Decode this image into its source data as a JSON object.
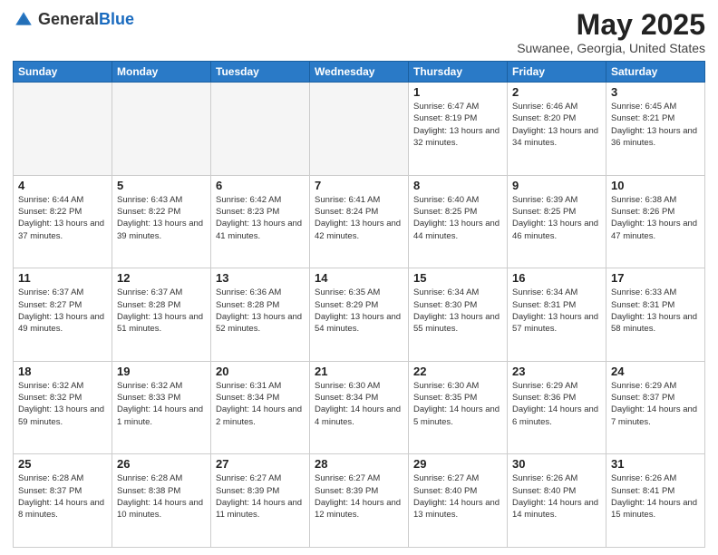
{
  "header": {
    "logo_general": "General",
    "logo_blue": "Blue",
    "month_year": "May 2025",
    "location": "Suwanee, Georgia, United States"
  },
  "days_of_week": [
    "Sunday",
    "Monday",
    "Tuesday",
    "Wednesday",
    "Thursday",
    "Friday",
    "Saturday"
  ],
  "weeks": [
    [
      {
        "day": "",
        "empty": true
      },
      {
        "day": "",
        "empty": true
      },
      {
        "day": "",
        "empty": true
      },
      {
        "day": "",
        "empty": true
      },
      {
        "day": "1",
        "sunrise": "6:47 AM",
        "sunset": "8:19 PM",
        "daylight": "13 hours and 32 minutes."
      },
      {
        "day": "2",
        "sunrise": "6:46 AM",
        "sunset": "8:20 PM",
        "daylight": "13 hours and 34 minutes."
      },
      {
        "day": "3",
        "sunrise": "6:45 AM",
        "sunset": "8:21 PM",
        "daylight": "13 hours and 36 minutes."
      }
    ],
    [
      {
        "day": "4",
        "sunrise": "6:44 AM",
        "sunset": "8:22 PM",
        "daylight": "13 hours and 37 minutes."
      },
      {
        "day": "5",
        "sunrise": "6:43 AM",
        "sunset": "8:22 PM",
        "daylight": "13 hours and 39 minutes."
      },
      {
        "day": "6",
        "sunrise": "6:42 AM",
        "sunset": "8:23 PM",
        "daylight": "13 hours and 41 minutes."
      },
      {
        "day": "7",
        "sunrise": "6:41 AM",
        "sunset": "8:24 PM",
        "daylight": "13 hours and 42 minutes."
      },
      {
        "day": "8",
        "sunrise": "6:40 AM",
        "sunset": "8:25 PM",
        "daylight": "13 hours and 44 minutes."
      },
      {
        "day": "9",
        "sunrise": "6:39 AM",
        "sunset": "8:25 PM",
        "daylight": "13 hours and 46 minutes."
      },
      {
        "day": "10",
        "sunrise": "6:38 AM",
        "sunset": "8:26 PM",
        "daylight": "13 hours and 47 minutes."
      }
    ],
    [
      {
        "day": "11",
        "sunrise": "6:37 AM",
        "sunset": "8:27 PM",
        "daylight": "13 hours and 49 minutes."
      },
      {
        "day": "12",
        "sunrise": "6:37 AM",
        "sunset": "8:28 PM",
        "daylight": "13 hours and 51 minutes."
      },
      {
        "day": "13",
        "sunrise": "6:36 AM",
        "sunset": "8:28 PM",
        "daylight": "13 hours and 52 minutes."
      },
      {
        "day": "14",
        "sunrise": "6:35 AM",
        "sunset": "8:29 PM",
        "daylight": "13 hours and 54 minutes."
      },
      {
        "day": "15",
        "sunrise": "6:34 AM",
        "sunset": "8:30 PM",
        "daylight": "13 hours and 55 minutes."
      },
      {
        "day": "16",
        "sunrise": "6:34 AM",
        "sunset": "8:31 PM",
        "daylight": "13 hours and 57 minutes."
      },
      {
        "day": "17",
        "sunrise": "6:33 AM",
        "sunset": "8:31 PM",
        "daylight": "13 hours and 58 minutes."
      }
    ],
    [
      {
        "day": "18",
        "sunrise": "6:32 AM",
        "sunset": "8:32 PM",
        "daylight": "13 hours and 59 minutes."
      },
      {
        "day": "19",
        "sunrise": "6:32 AM",
        "sunset": "8:33 PM",
        "daylight": "14 hours and 1 minute."
      },
      {
        "day": "20",
        "sunrise": "6:31 AM",
        "sunset": "8:34 PM",
        "daylight": "14 hours and 2 minutes."
      },
      {
        "day": "21",
        "sunrise": "6:30 AM",
        "sunset": "8:34 PM",
        "daylight": "14 hours and 4 minutes."
      },
      {
        "day": "22",
        "sunrise": "6:30 AM",
        "sunset": "8:35 PM",
        "daylight": "14 hours and 5 minutes."
      },
      {
        "day": "23",
        "sunrise": "6:29 AM",
        "sunset": "8:36 PM",
        "daylight": "14 hours and 6 minutes."
      },
      {
        "day": "24",
        "sunrise": "6:29 AM",
        "sunset": "8:37 PM",
        "daylight": "14 hours and 7 minutes."
      }
    ],
    [
      {
        "day": "25",
        "sunrise": "6:28 AM",
        "sunset": "8:37 PM",
        "daylight": "14 hours and 8 minutes."
      },
      {
        "day": "26",
        "sunrise": "6:28 AM",
        "sunset": "8:38 PM",
        "daylight": "14 hours and 10 minutes."
      },
      {
        "day": "27",
        "sunrise": "6:27 AM",
        "sunset": "8:39 PM",
        "daylight": "14 hours and 11 minutes."
      },
      {
        "day": "28",
        "sunrise": "6:27 AM",
        "sunset": "8:39 PM",
        "daylight": "14 hours and 12 minutes."
      },
      {
        "day": "29",
        "sunrise": "6:27 AM",
        "sunset": "8:40 PM",
        "daylight": "14 hours and 13 minutes."
      },
      {
        "day": "30",
        "sunrise": "6:26 AM",
        "sunset": "8:40 PM",
        "daylight": "14 hours and 14 minutes."
      },
      {
        "day": "31",
        "sunrise": "6:26 AM",
        "sunset": "8:41 PM",
        "daylight": "14 hours and 15 minutes."
      }
    ]
  ],
  "labels": {
    "sunrise": "Sunrise:",
    "sunset": "Sunset:",
    "daylight": "Daylight:"
  }
}
